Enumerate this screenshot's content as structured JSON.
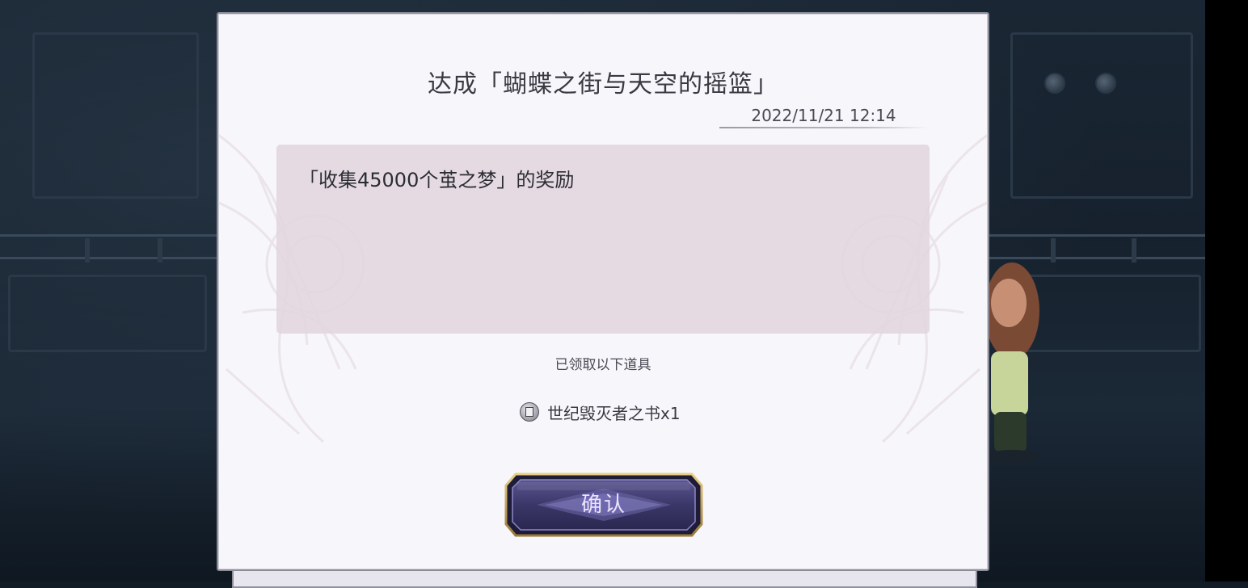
{
  "dialog": {
    "title": "达成「蝴蝶之街与天空的摇篮」",
    "timestamp": "2022/11/21 12:14",
    "message": "「收集45000个茧之梦」的奖励",
    "received_label": "已领取以下道具",
    "reward_item": {
      "icon": "book-icon",
      "label": "世纪毁灭者之书x1"
    },
    "confirm_label": "确认"
  },
  "colors": {
    "dialog_background": "#f7f6fa",
    "message_box": "#e4d9e0",
    "button_fill": "#3d3a66",
    "button_border": "#c9a45a"
  }
}
